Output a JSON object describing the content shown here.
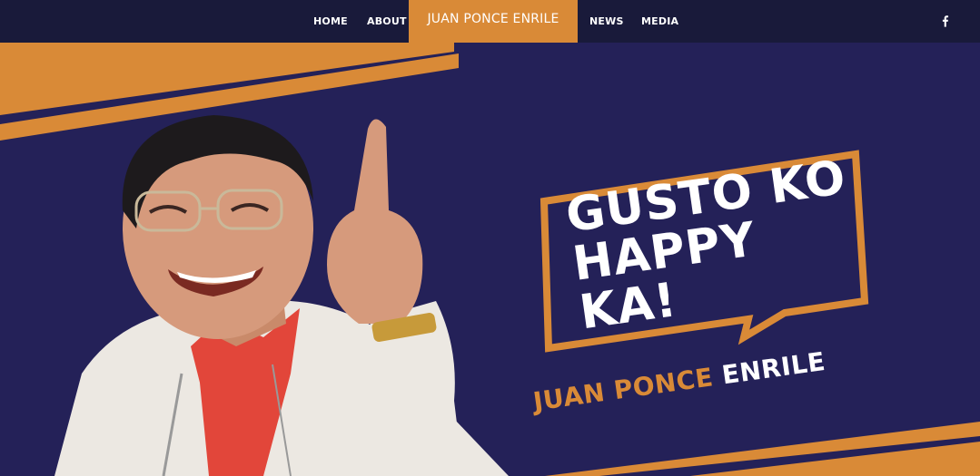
{
  "nav": {
    "items": [
      {
        "label": "HOME"
      },
      {
        "label": "ABOUT"
      },
      {
        "label": "JUAN PONCE ENRILE"
      },
      {
        "label": "NEWS"
      },
      {
        "label": "MEDIA"
      }
    ],
    "social_icon": "facebook-icon",
    "active_color": "#d98a37",
    "bar_color": "#191a3a"
  },
  "hero": {
    "slogan_line1": "GUSTO KO",
    "slogan_line2": "HAPPY KA!",
    "name_first": "JUAN PONCE",
    "name_last": "ENRILE",
    "background_color": "#242158",
    "accent_color": "#d98a37"
  }
}
